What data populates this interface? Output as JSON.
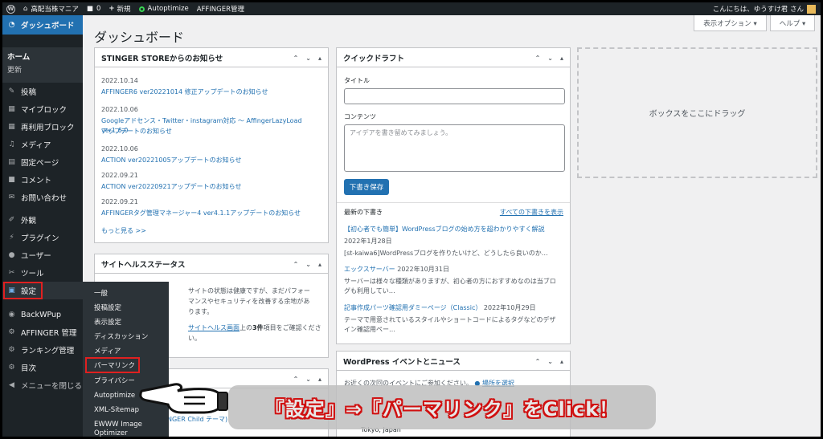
{
  "adminbar": {
    "site_name": "高配当株マニア",
    "comments": "0",
    "new": "新規",
    "autoptimize": "Autoptimize",
    "affinger": "AFFINGER管理",
    "greeting": "こんにちは、ゆうすけ君 さん"
  },
  "sidebar": {
    "dashboard": "ダッシュボード",
    "home": "ホーム",
    "updates": "更新",
    "items": [
      {
        "label": "投稿",
        "icon": "pin-icon"
      },
      {
        "label": "マイブロック",
        "icon": "grid-icon"
      },
      {
        "label": "再利用ブロック",
        "icon": "grid-icon"
      },
      {
        "label": "メディア",
        "icon": "media-icon"
      },
      {
        "label": "固定ページ",
        "icon": "page-icon"
      },
      {
        "label": "コメント",
        "icon": "comment-icon"
      },
      {
        "label": "お問い合わせ",
        "icon": "mail-icon"
      },
      {
        "label": "外観",
        "icon": "brush-icon"
      },
      {
        "label": "プラグイン",
        "icon": "plugin-icon"
      },
      {
        "label": "ユーザー",
        "icon": "user-icon"
      },
      {
        "label": "ツール",
        "icon": "wrench-icon"
      },
      {
        "label": "設定",
        "icon": "settings-icon"
      },
      {
        "label": "BackWPup",
        "icon": "backwpup-icon"
      },
      {
        "label": "AFFINGER 管理",
        "icon": "gear-icon"
      },
      {
        "label": "ランキング管理",
        "icon": "gear-icon"
      },
      {
        "label": "目次",
        "icon": "gear-icon"
      },
      {
        "label": "メニューを閉じる",
        "icon": "collapse-icon"
      }
    ]
  },
  "flyout": {
    "items": [
      "一般",
      "投稿設定",
      "表示設定",
      "ディスカッション",
      "メディア",
      "パーマリンク",
      "プライバシー",
      "Autoptimize",
      "XML-Sitemap",
      "EWWW Image",
      "Optimizer"
    ]
  },
  "header": {
    "title": "ダッシュボード",
    "screen_options": "表示オプション ▾",
    "help": "ヘルプ ▾"
  },
  "news": {
    "title": "STINGER STOREからのお知らせ",
    "entries": [
      {
        "date": "2022.10.14",
        "title": "AFFINGER6 ver20221014 修正アップデートのお知らせ"
      },
      {
        "date": "2022.10.06",
        "title": "Googleアドセンス・Twitter・instagram対応 〜 AffingerLazyLoad ver1.6.0",
        "title2": "アップデートのお知らせ"
      },
      {
        "date": "2022.10.06",
        "title": "ACTION ver20221005アップデートのお知らせ"
      },
      {
        "date": "2022.09.21",
        "title": "ACTION ver20220921アップデートのお知らせ"
      },
      {
        "date": "2022.09.21",
        "title": "AFFINGERタグ管理マネージャー4 ver4.1.1アップデートのお知らせ"
      }
    ],
    "more": "もっと見る >>"
  },
  "health": {
    "title": "サイトヘルスステータス",
    "line1": "サイトの状態は健康ですが、まだパフォー",
    "line2": "マンスやセキュリティを改善する余地があ",
    "line3": "ります。",
    "line4_pre": "サイトヘルス画面",
    "line4_post": "上の",
    "line4_bold": "3件",
    "line4_tail": "項目をご確認くださ",
    "line5": "い。"
  },
  "glance": {
    "theme_text": "NGER Child テーマ)"
  },
  "draft": {
    "title": "クイックドラフト",
    "title_label": "タイトル",
    "content_label": "コンテンツ",
    "content_placeholder": "アイデアを書き留めてみましょう。",
    "save": "下書き保存",
    "recent_label": "最新の下書き",
    "view_all": "すべての下書きを表示",
    "drafts": [
      {
        "title": "【初心者でも簡単】WordPressブログの始め方を超わかりやすく解説",
        "date": "2022年1月28日",
        "excerpt": "[st-kaiwa6]WordPressブログを作りたいけど、どうしたら良いのか…"
      },
      {
        "title": "エックスサーバー",
        "date": "2022年10月31日",
        "excerpt": "サーバーは様々な種類がありますが、初心者の方におすすめなのは当ブロ",
        "excerpt2": "グも利用してい…"
      },
      {
        "title": "記事作成パーツ確認用ダミーページ（Classic）",
        "date": "2022年10月29日",
        "excerpt": "テーマで用意されているスタイルやショートコードによるタグなどのデザ",
        "excerpt2": "イン確認用ペー…"
      }
    ]
  },
  "events": {
    "title": "WordPress イベントとニュース",
    "intro": "お近くの次回のイベントにご参加ください。",
    "select": "場所を選択",
    "location": "Tokyo, Japan"
  },
  "dropzone": "ボックスをここにドラッグ",
  "callout": "『設定』⇒『パーマリンク』をClick！"
}
